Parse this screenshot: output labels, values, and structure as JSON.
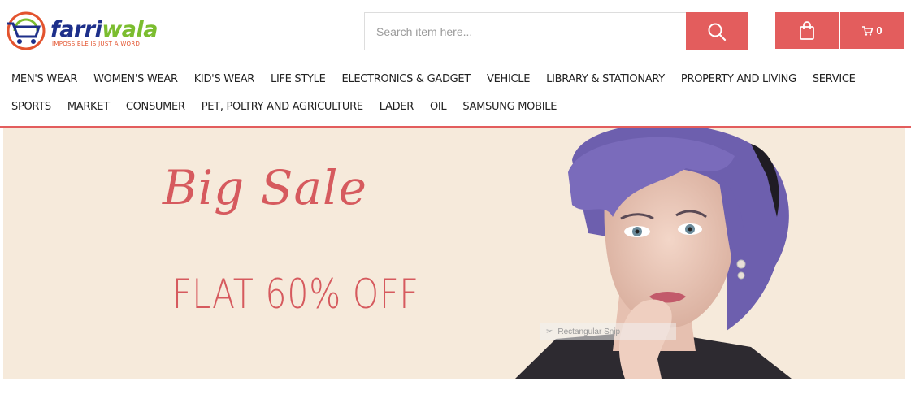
{
  "brand": {
    "name_part1": "farri",
    "name_part2": "wala",
    "tagline": "IMPOSSIBLE IS JUST A WORD"
  },
  "search": {
    "placeholder": "Search item here...",
    "icon": "search-icon"
  },
  "cart": {
    "bag_icon": "shopping-bag-icon",
    "cart_icon": "cart-icon",
    "count": "0"
  },
  "nav": {
    "row1": [
      "MEN'S WEAR",
      "WOMEN'S WEAR",
      "KID'S WEAR",
      "LIFE STYLE",
      "ELECTRONICS & GADGET",
      "VEHICLE",
      "LIBRARY & STATIONARY",
      "PROPERTY AND LIVING",
      "SERVICE"
    ],
    "row2": [
      "SPORTS",
      "MARKET",
      "CONSUMER",
      "PET, POLTRY AND AGRICULTURE",
      "LADER",
      "OIL",
      "SAMSUNG MOBILE"
    ]
  },
  "banner": {
    "headline": "Big Sale",
    "offer": "FLAT 60% OFF",
    "overlay_label": "Rectangular Snip"
  },
  "colors": {
    "accent": "#e35d5d",
    "banner_bg": "#f6eadb",
    "banner_text": "#d65a5e",
    "brand_blue": "#1d2f8a",
    "brand_green": "#7bbd2f"
  }
}
